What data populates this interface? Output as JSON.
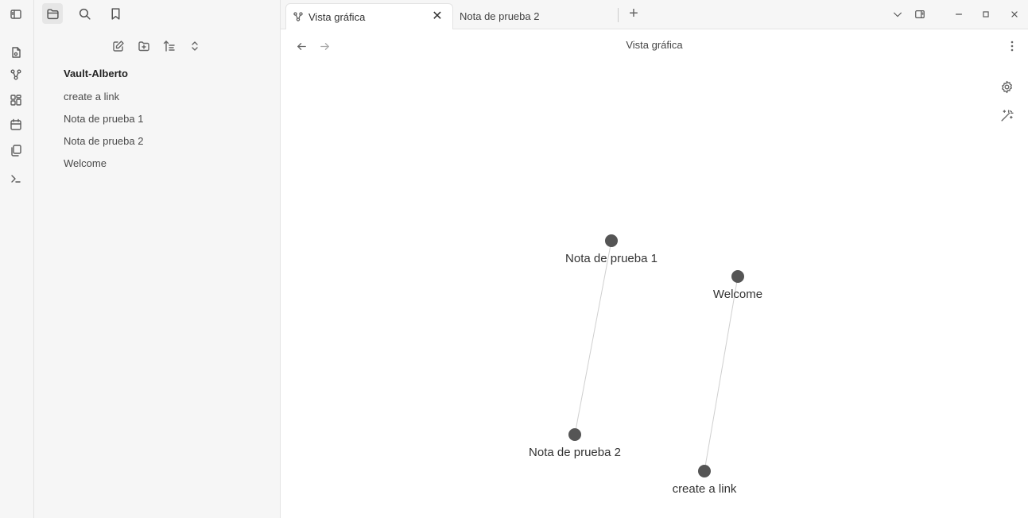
{
  "sidebar": {
    "vault_name": "Vault-Alberto",
    "files": [
      "create a link",
      "Nota de prueba 1",
      "Nota de prueba 2",
      "Welcome"
    ]
  },
  "tabs": [
    {
      "label": "Vista gráfica",
      "icon": "graph-icon",
      "active": true
    },
    {
      "label": "Nota de prueba 2",
      "active": false
    }
  ],
  "view": {
    "title": "Vista gráfica"
  },
  "graph": {
    "nodes": [
      {
        "id": "nota1",
        "label": "Nota de prueba 1"
      },
      {
        "id": "welcome",
        "label": "Welcome"
      },
      {
        "id": "nota2",
        "label": "Nota de prueba 2"
      },
      {
        "id": "link",
        "label": "create a link"
      }
    ],
    "edges": [
      [
        "nota1",
        "nota2"
      ],
      [
        "welcome",
        "link"
      ]
    ]
  },
  "colors": {
    "node": "#555555",
    "edge": "#cfcfcf",
    "panel": "#f6f6f6"
  }
}
